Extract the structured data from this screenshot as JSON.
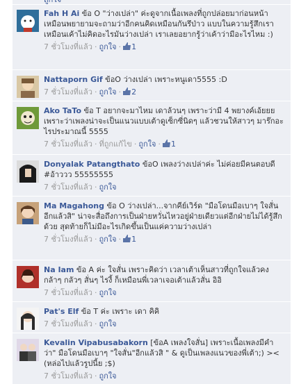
{
  "header": {
    "like_label": "ถูกใจ"
  },
  "comments": [
    {
      "author": "Fah H Ai",
      "text": " ข้อ O \"ว่างเปล่า\" ค่ะดูจากเนื้อเพลงที่ถูกปล่อยมาก่อนหน้า เหมือนพยายามจะถามว่าอีกคนคิดเหมือนกันรึป่าว แบบในความรู้สึกเราเหมือนเค้าไม่คิดอะไรมันว่างเปล่า เราเลยอยากรู้ว่าเค้าว่ามีอะไรไหม :)",
      "time": "7 ชั่วโมงที่แล้ว",
      "like": "ถูกใจ",
      "likes": "1"
    },
    {
      "author": "Nattaporn Gif",
      "text": " ข้อO ว่างเปล่า เพราะหนูเดา5555 :D",
      "time": "7 ชั่วโมงที่แล้ว",
      "like": "ถูกใจ",
      "likes": "2"
    },
    {
      "author": "Ako TaTo",
      "text": " ข้อ T อยากจะมาไหม เดาล้วนๆ เพราะว่ามี 4 พยางค์เอ้ยยย เพราะว่าเพลงน่าจะเป็นแนวแบบเต้าดูเซ็กซี่นิดๆ แล้วชวนให้สาวๆ มาร๊กอะไรประมาณนี้ 5555",
      "time": "7 ชั่วโมงที่แล้ว",
      "unlike": "ที่ถูกแก้ไข",
      "like": "ถูกใจ",
      "likes": "1"
    },
    {
      "author": "Donyalak Patangthato",
      "text": " ข้อO เพลงว่างเปล่าค่ะ ไม่ค่อยมีคนตอบดี #อ้าววว 55555555",
      "time": "7 ชั่วโมงที่แล้ว",
      "like": "ถูกใจ"
    },
    {
      "author": "Ma Magahong",
      "text": " ข้อ O ว่างเปล่า...จากคีย์เวิร์ด \"มือโดนมือเบาๆ ใจสั่นอีกแล้วสิ\" น่าจะสื่อถึงการเป็นฝ่ายหวั่นไหวอยู่ฝ่ายเดียวแต่อีกฝ่ายไม่ได้รู้สึกด้วย สุดท้ายก็ไม่มีอะไรเกิดขึ้นเป็นแค่ความว่างเปล่า",
      "time": "7 ชั่วโมงที่แล้ว",
      "like": "ถูกใจ",
      "likes": "1"
    },
    {
      "author": "Na Iam",
      "text": " ข้อ A ค่ะ ใจสั่น เพราะคิดว่า เวลาเต้าเห็นสาวที่ถูกใจแล้วคง กล้าๆ กลัวๆ สั่นๆ ไรงี้ ก็เหมือนพี่เวลาเจอเต้าแล้วสั่น อิอิ",
      "time": "7 ชั่วโมงที่แล้ว",
      "like": "ถูกใจ"
    },
    {
      "author": "Pat's Elf",
      "text": " ข้อ T ค่ะ เพราะ เดา คิคิ",
      "time": "7 ชั่วโมงที่แล้ว",
      "like": "ถูกใจ"
    },
    {
      "author": "Kevalin Vipabusabakorn",
      "text": " [ข้อA เพลงใจสั่น] เพราะเนื้อเพลงมีคำว่า\" มือโดนมือเบาๆ \"ใจสั่น\"อีกแล้วสิ \" & ดูเป็นเพลงแนวของพี่เต้า;) >< (หล่อไปแล้วรูปนี้ย ;$)",
      "time": "7 ชั่วโมงที่แล้ว",
      "like": "ถูกใจ"
    }
  ],
  "colors": {
    "link": "#3b5998",
    "panel": "#edeff4",
    "meta": "#999999"
  }
}
